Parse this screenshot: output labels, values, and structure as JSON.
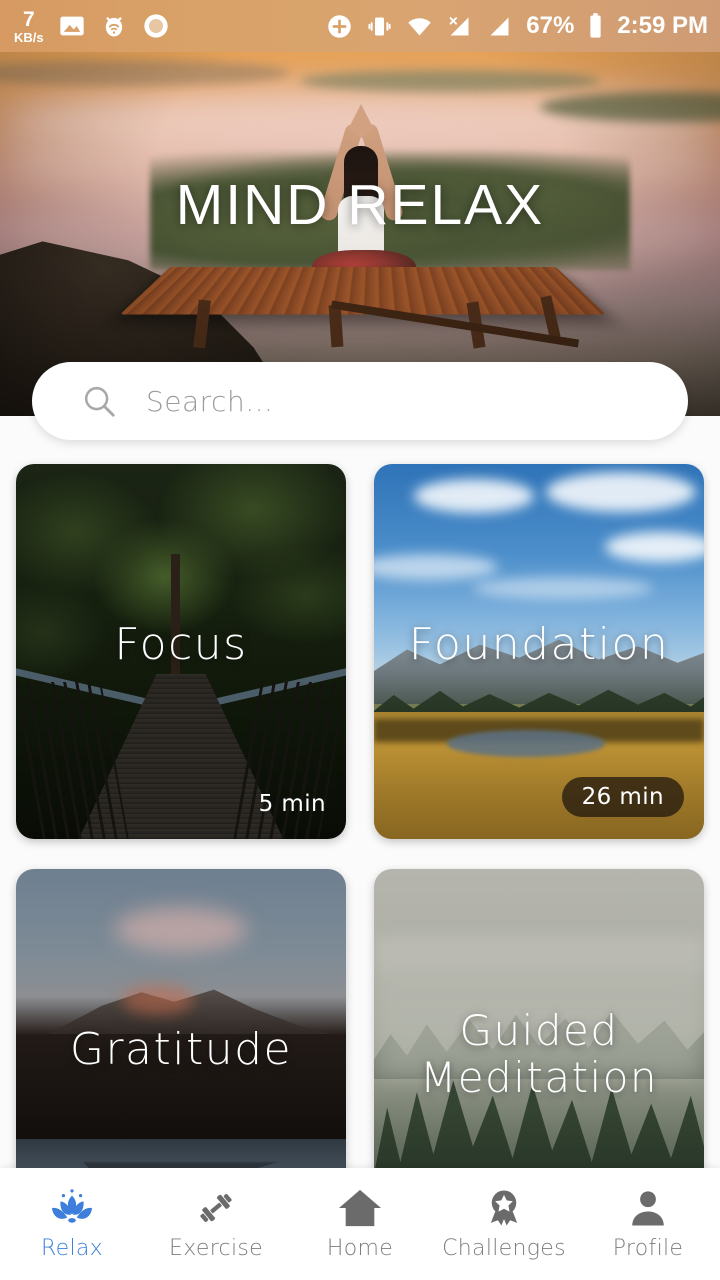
{
  "status_bar": {
    "net_speed_value": "7",
    "net_speed_unit": "KB/s",
    "icons_left": [
      "photo-icon",
      "bug-wifi-icon",
      "circle-record-icon"
    ],
    "icons_right": [
      "add-circle-icon",
      "vibrate-icon",
      "wifi-icon",
      "signal-no-sim-icon",
      "signal-bars-icon"
    ],
    "battery_percent": "67%",
    "battery_icon": "battery-icon",
    "time": "2:59 PM"
  },
  "hero": {
    "title": "MIND RELAX",
    "image_alt": "woman-meditating-yoga-sunrise-deck"
  },
  "search": {
    "placeholder": "Search...",
    "value": "",
    "icon": "search-icon"
  },
  "cards": [
    {
      "title": "Focus",
      "duration": "5 min",
      "badge_pill": false,
      "art": "art-focus"
    },
    {
      "title": "Foundation",
      "duration": "26 min",
      "badge_pill": true,
      "art": "art-foundation"
    },
    {
      "title": "Gratitude",
      "duration": "",
      "badge_pill": false,
      "art": "art-gratitude"
    },
    {
      "title": "Guided\nMeditation",
      "title_line1": "Guided",
      "title_line2": "Meditation",
      "duration": "",
      "badge_pill": false,
      "art": "art-guided"
    }
  ],
  "bottom_nav": {
    "active_index": 0,
    "active_color": "#3d7fdb",
    "inactive_color": "#7d7d7d",
    "items": [
      {
        "label": "Relax",
        "icon": "lotus-icon"
      },
      {
        "label": "Exercise",
        "icon": "dumbbell-icon"
      },
      {
        "label": "Home",
        "icon": "home-icon"
      },
      {
        "label": "Challenges",
        "icon": "award-ribbon-icon"
      },
      {
        "label": "Profile",
        "icon": "person-icon"
      }
    ]
  }
}
